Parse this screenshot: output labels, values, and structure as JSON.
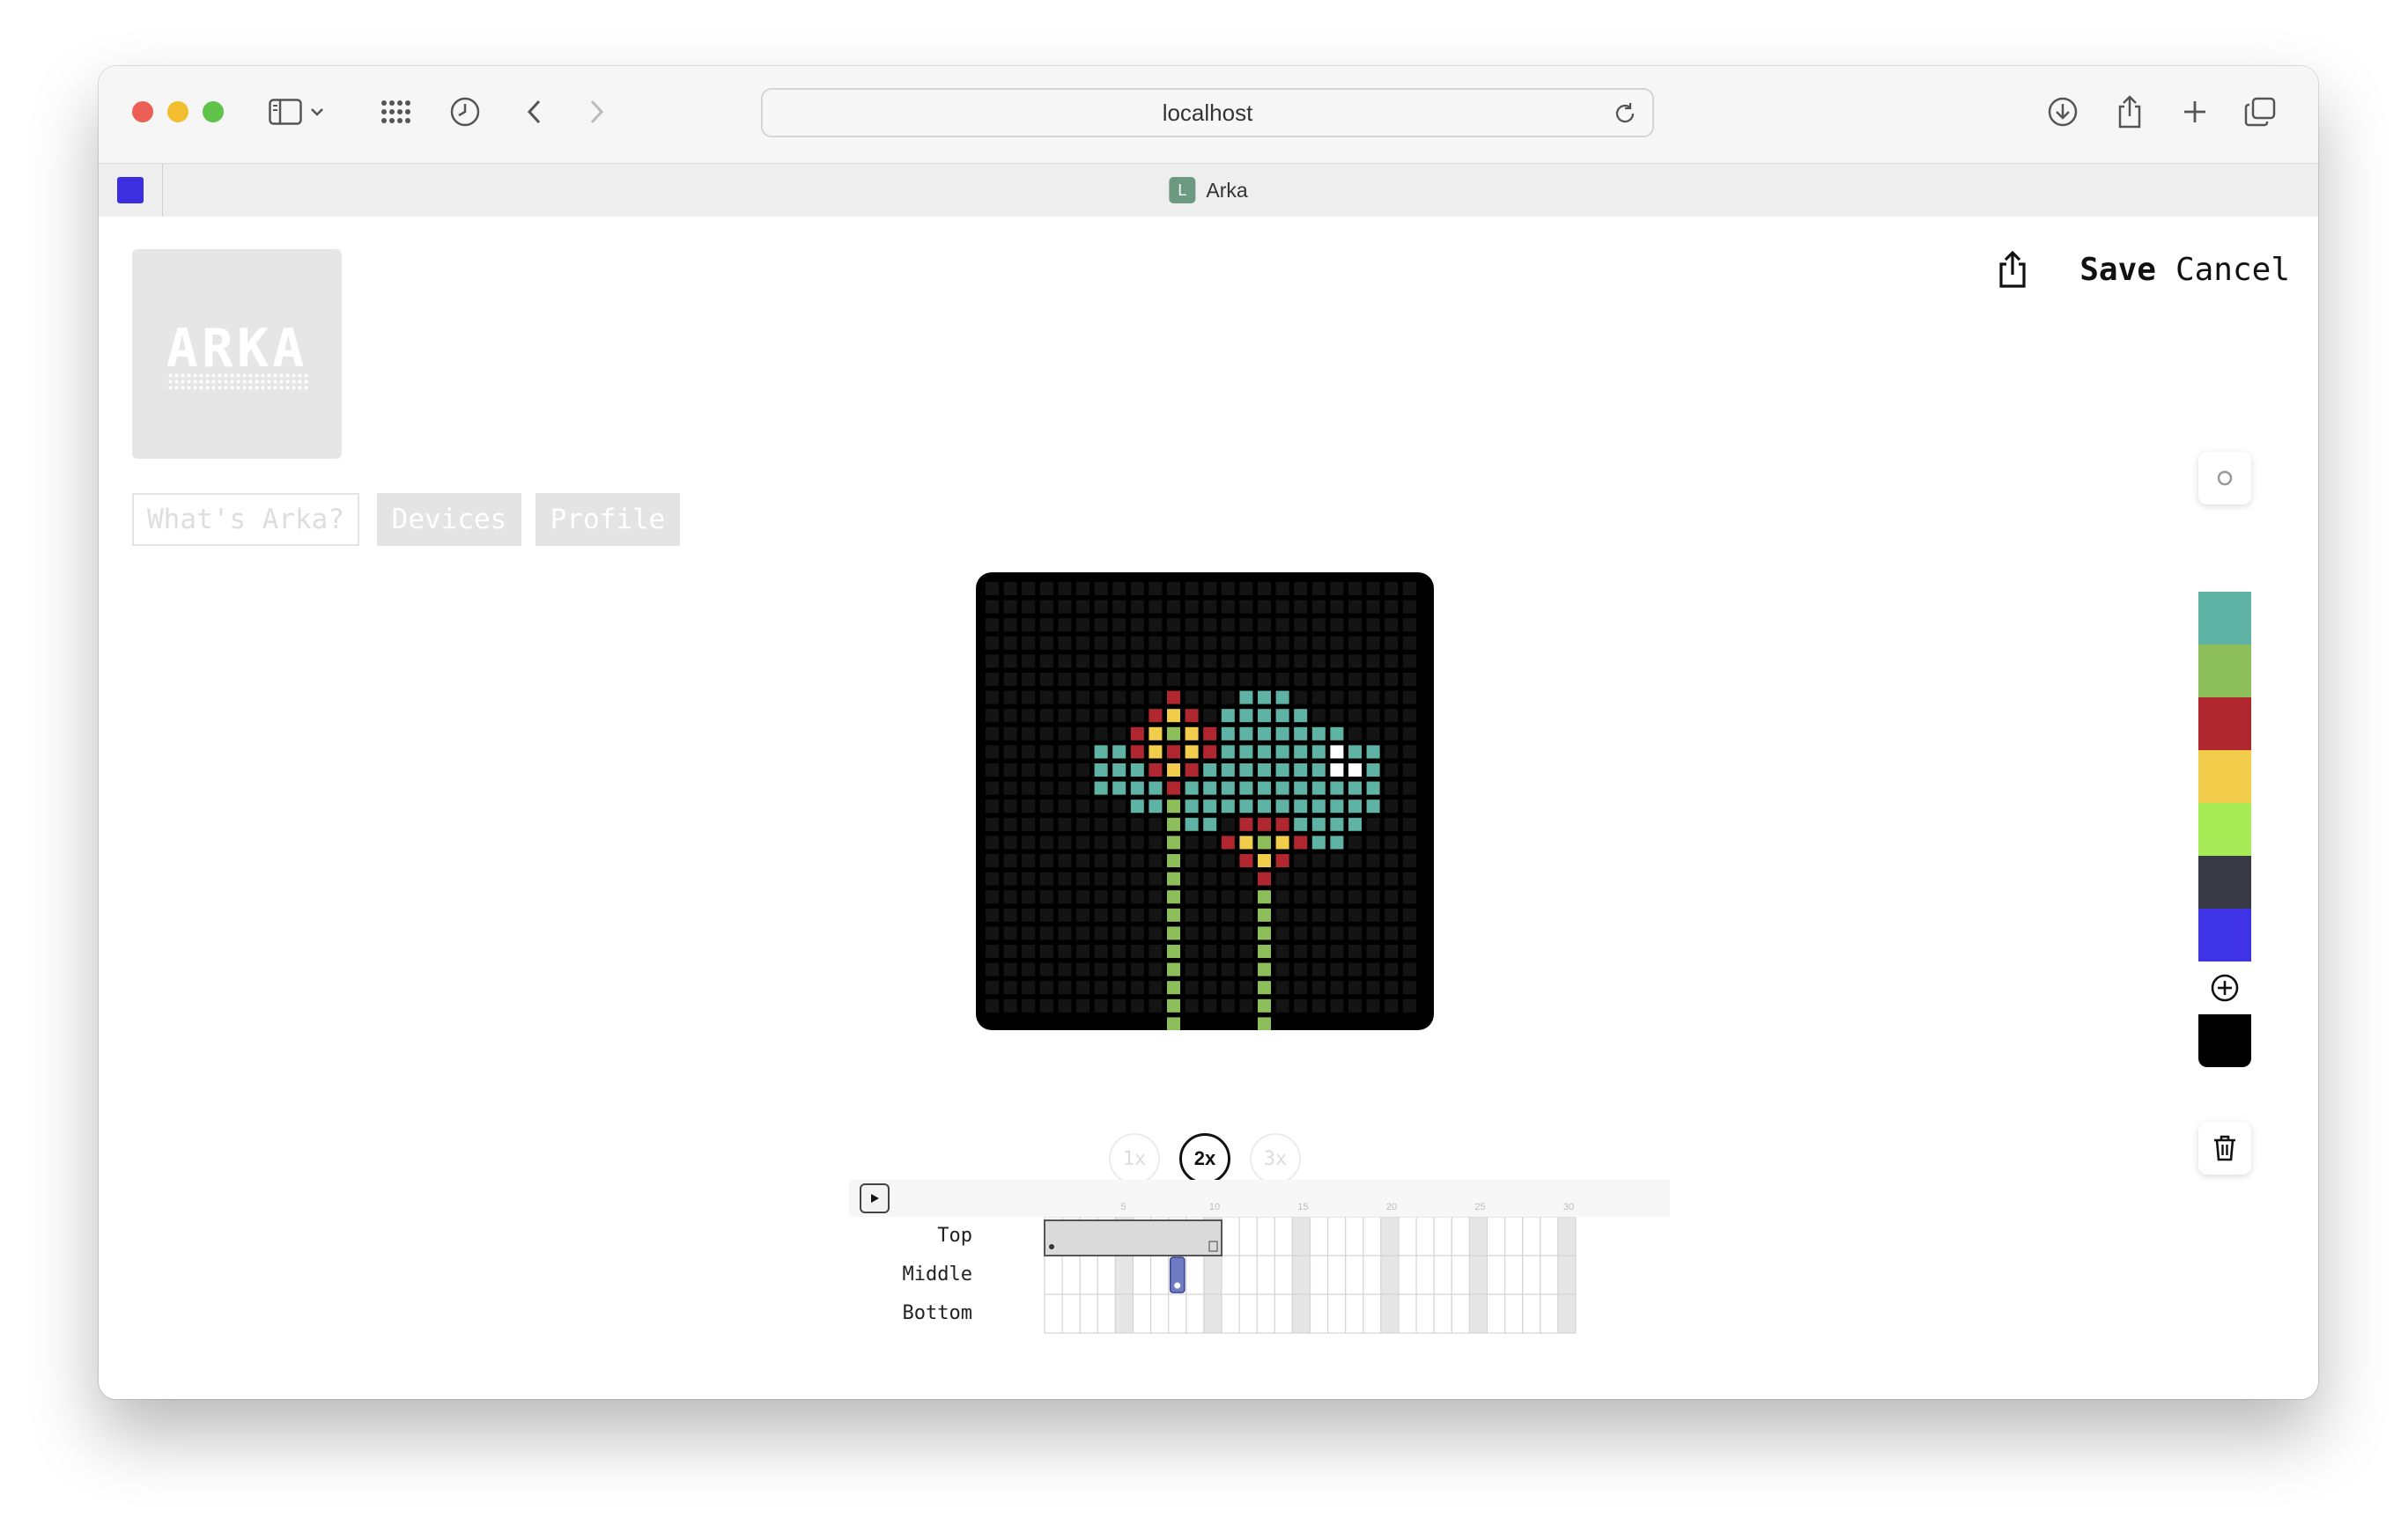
{
  "browser": {
    "url": "localhost",
    "tab_title": "Arka",
    "tab_favicon_letter": "L"
  },
  "app": {
    "logo_text": "ARKA",
    "nav": {
      "whats_arka": "What's Arka?",
      "devices": "Devices",
      "profile": "Profile"
    },
    "actions": {
      "save": "Save",
      "cancel": "Cancel"
    },
    "speeds": [
      "1x",
      "2x",
      "3x"
    ],
    "selected_speed": "2x",
    "palette": [
      "#ffffff",
      "#5fb3a4",
      "#8cbf5a",
      "#b1272f",
      "#f1cd4b",
      "#a6ea55",
      "#373a44",
      "#3f33e6"
    ],
    "palette_selected": "#000000",
    "timeline": {
      "tracks": [
        "Top",
        "Middle",
        "Bottom"
      ],
      "ruler_marks": [
        "5",
        "10",
        "15",
        "20",
        "25",
        "30"
      ]
    }
  },
  "colors": {
    "teal": "#5fb3a4",
    "green": "#8cbf5a",
    "red": "#b1272f",
    "yellow": "#f1cd4b",
    "white": "#ffffff"
  }
}
